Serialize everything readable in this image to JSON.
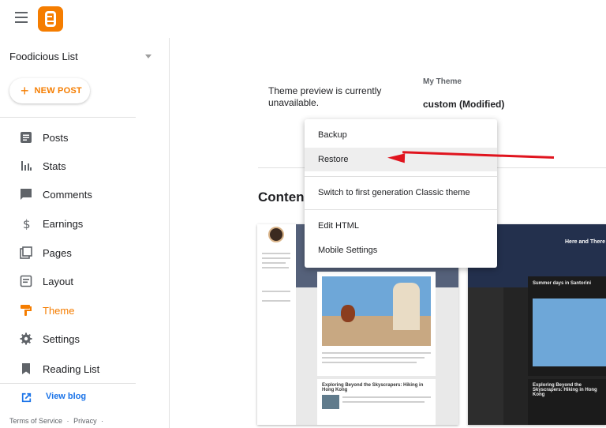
{
  "header": {
    "menu_icon": "hamburger-icon",
    "logo_icon": "blogger-logo-icon"
  },
  "sidebar": {
    "blog_name": "Foodicious List",
    "new_post_label": "NEW POST",
    "items": [
      {
        "label": "Posts",
        "icon": "posts-icon"
      },
      {
        "label": "Stats",
        "icon": "stats-icon"
      },
      {
        "label": "Comments",
        "icon": "comments-icon"
      },
      {
        "label": "Earnings",
        "icon": "dollar-icon"
      },
      {
        "label": "Pages",
        "icon": "pages-icon"
      },
      {
        "label": "Layout",
        "icon": "layout-icon"
      },
      {
        "label": "Theme",
        "icon": "theme-icon"
      },
      {
        "label": "Settings",
        "icon": "gear-icon"
      },
      {
        "label": "Reading List",
        "icon": "bookmark-icon"
      }
    ],
    "active_item": "Theme",
    "view_blog_label": "View blog",
    "footer": {
      "terms": "Terms of Service",
      "sep": "·",
      "privacy": "Privacy",
      "sep2": "·"
    }
  },
  "main": {
    "preview_message": "Theme preview is currently unavailable.",
    "theme_label": "My Theme",
    "theme_name": "custom (Modified)",
    "content_heading": "Conten",
    "thumb1": {
      "post1_title": "Exploring Beyond the Skyscrapers: Hiking in Hong Kong"
    },
    "thumb2": {
      "hero_title": "Here and There",
      "post1_title": "Summer days in Santorini",
      "post2_title": "Exploring Beyond the Skyscrapers: Hiking in Hong Kong"
    }
  },
  "menu": {
    "items": [
      {
        "label": "Backup"
      },
      {
        "label": "Restore"
      },
      {
        "label": "Switch to first generation Classic theme"
      },
      {
        "label": "Edit HTML"
      },
      {
        "label": "Mobile Settings"
      }
    ],
    "hovered": "Restore"
  },
  "colors": {
    "accent": "#f57d00",
    "link": "#1a73e8",
    "annotation_arrow": "#e0141e"
  }
}
